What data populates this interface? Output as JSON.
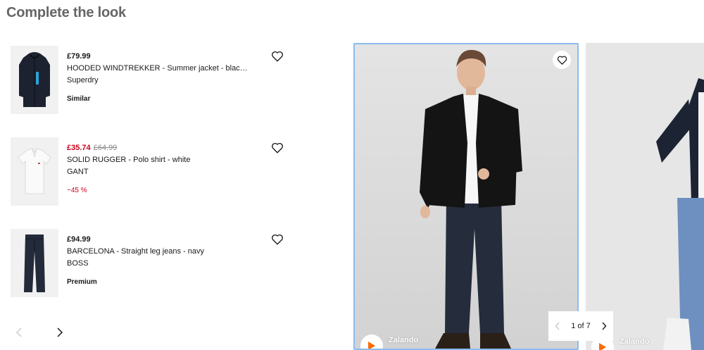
{
  "section": {
    "title": "Complete the look"
  },
  "products": [
    {
      "price": "£79.99",
      "name": "HOODED WINDTREKKER - Summer jacket - blac…",
      "brand": "Superdry",
      "tag": "Similar"
    },
    {
      "price": "£35.74",
      "original_price": "£64.99",
      "name": "SOLID RUGGER - Polo shirt - white",
      "brand": "GANT",
      "tag": "−45 %"
    },
    {
      "price": "£94.99",
      "name": "BARCELONA - Straight leg jeans - navy",
      "brand": "BOSS",
      "tag": "Premium"
    }
  ],
  "carousel": {
    "cards": [
      {
        "brand": "Zalando"
      },
      {
        "brand": "Zalando"
      }
    ],
    "pager": {
      "text": "1 of 7"
    }
  },
  "colors": {
    "sale": "#d0021b",
    "accent_border": "#8bbcf0",
    "brand_orange": "#ff6900"
  }
}
